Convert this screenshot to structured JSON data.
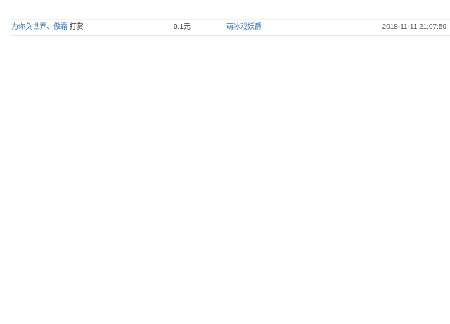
{
  "tips": [
    {
      "tipper": "为你负世界、傲霜",
      "action": "打赏",
      "amount": "0.1元",
      "recipient": "萌冰戏妖爵",
      "time": "2018-11-11 21:07:50"
    }
  ]
}
